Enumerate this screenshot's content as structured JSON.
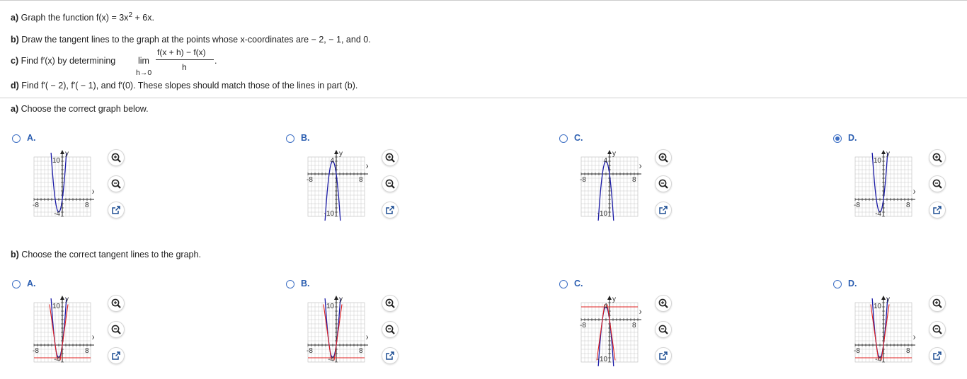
{
  "problem": {
    "a_label": "a)",
    "a_text": "Graph the function f(x) = 3x",
    "a_exp": "2",
    "a_tail": " + 6x.",
    "b_label": "b)",
    "b_text": "Draw the tangent lines to the graph at the points whose x-coordinates are  − 2,  − 1, and 0.",
    "c_label": "c)",
    "c_text": "Find f′(x) by determining",
    "c_lim": "lim",
    "c_sub": "h→0",
    "c_num": "f(x + h) − f(x)",
    "c_den": "h",
    "c_period": ".",
    "d_label": "d)",
    "d_text": "Find f′( − 2), f′( − 1), and f′(0). These slopes should match those of the lines in part (b)."
  },
  "part_a": {
    "prompt_label": "a)",
    "prompt_text": "Choose the correct graph below.",
    "selected": "D",
    "options": [
      {
        "label": "A.",
        "selected": false,
        "y_top": "10",
        "y_bot": "-4",
        "x_left": "-8",
        "x_right": "8"
      },
      {
        "label": "B.",
        "selected": false,
        "y_top": "4",
        "y_bot": "-10",
        "x_left": "-8",
        "x_right": "8"
      },
      {
        "label": "C.",
        "selected": false,
        "y_top": "4",
        "y_bot": "-10",
        "x_left": "-8",
        "x_right": "8"
      },
      {
        "label": "D.",
        "selected": true,
        "y_top": "10",
        "y_bot": "-4",
        "x_left": "-8",
        "x_right": "8"
      }
    ]
  },
  "part_b": {
    "prompt_label": "b)",
    "prompt_text": "Choose the correct tangent lines to the graph.",
    "options": [
      {
        "label": "A.",
        "selected": false,
        "y_top": "10",
        "y_bot": "-4",
        "x_left": "-8",
        "x_right": "8"
      },
      {
        "label": "B.",
        "selected": false,
        "y_top": "10",
        "y_bot": "-4",
        "x_left": "-8",
        "x_right": "8"
      },
      {
        "label": "C.",
        "selected": false,
        "y_top": "4",
        "y_bot": "-10",
        "x_left": "-8",
        "x_right": "8"
      },
      {
        "label": "D.",
        "selected": false,
        "y_top": "10",
        "y_bot": "-4",
        "x_left": "-8",
        "x_right": "8"
      }
    ]
  },
  "axis_names": {
    "x": "x",
    "y": "y"
  },
  "icons": [
    "zoom-in-icon",
    "zoom-out-icon",
    "open-new-window-icon"
  ],
  "colors": {
    "accent": "#3d6fc4",
    "curve": "#1a1aa6",
    "tangent": "#e02020",
    "grid": "#c9c9c9"
  }
}
